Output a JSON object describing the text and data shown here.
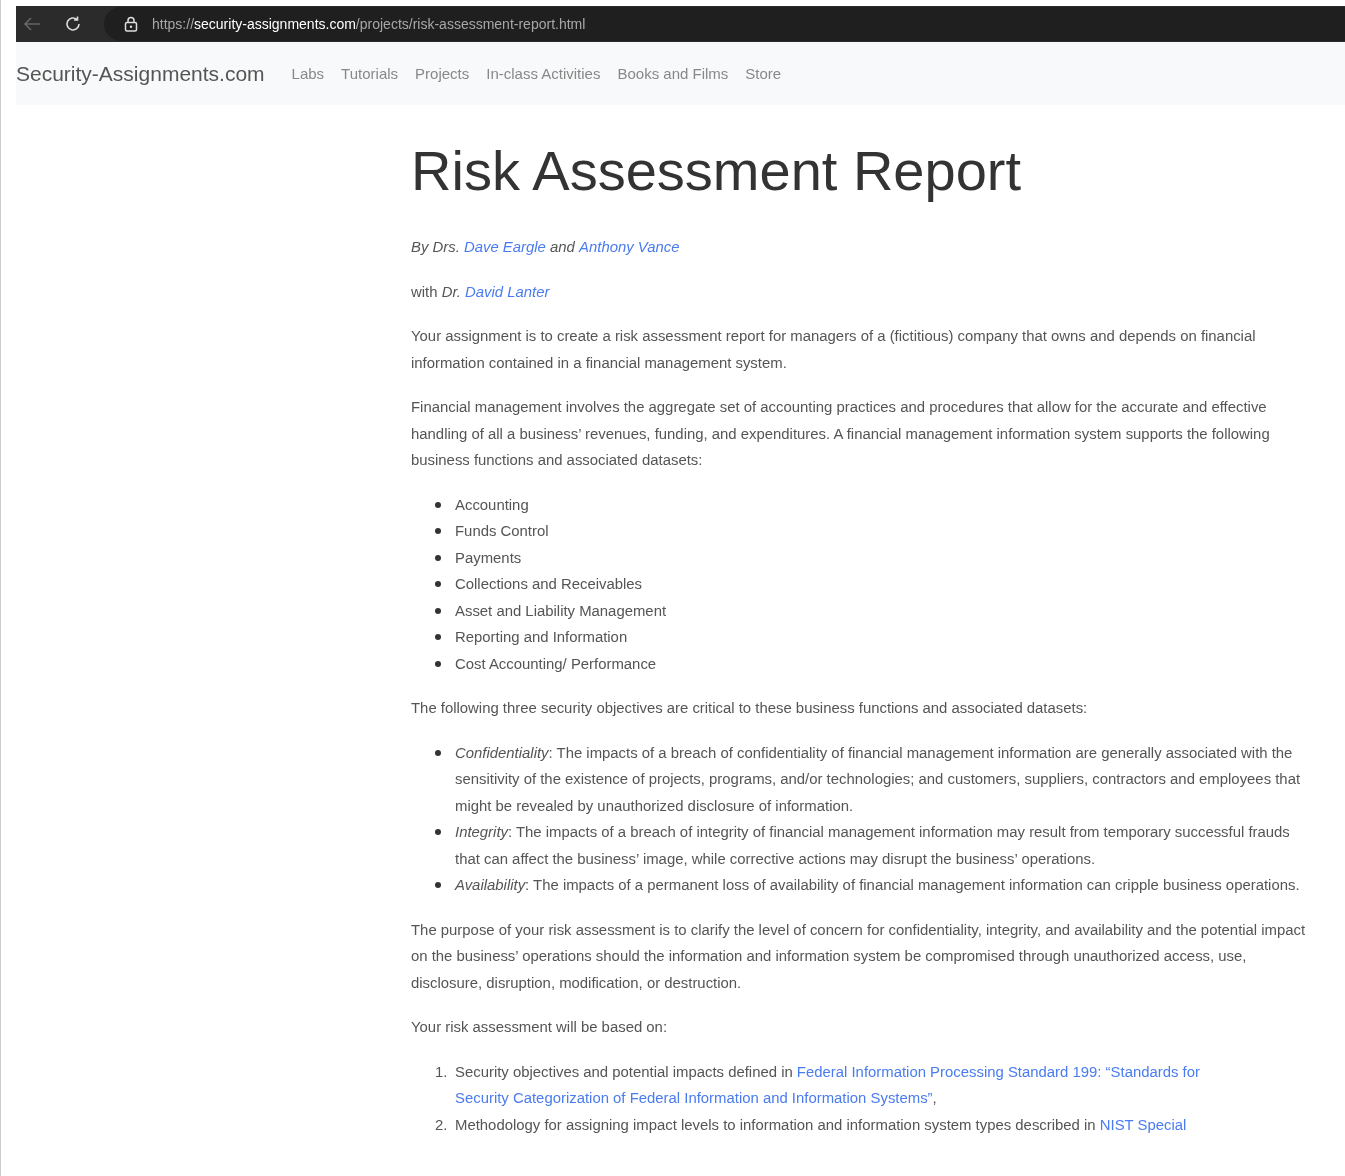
{
  "browser": {
    "url": "https://**security-assignments.com**/projects/risk-assessment-report.html"
  },
  "navbar": {
    "brand": "Security-Assignments.com",
    "links": [
      "Labs",
      "Tutorials",
      "Projects",
      "In-class Activities",
      "Books and Films",
      "Store"
    ]
  },
  "article": {
    "title": "Risk Assessment Report",
    "blocks": [
      {
        "kind": "para",
        "parts": [
          {
            "kind": "text",
            "text": "*By Drs.*"
          },
          {
            "kind": "link",
            "text": "Dave Eargle"
          },
          {
            "kind": "text",
            "text": "*and*"
          },
          {
            "kind": "link",
            "text": "Anthony Vance"
          }
        ]
      },
      {
        "kind": "para",
        "parts": [
          {
            "kind": "text",
            "text": "with *Dr.*"
          },
          {
            "kind": "link",
            "text": "David Lanter"
          }
        ]
      },
      {
        "kind": "para",
        "parts": [
          {
            "kind": "text",
            "text": "Your assignment is to create a risk assessment report for managers of a (fictitious) company that owns and depends on financial information contained in a financial management system."
          }
        ]
      },
      {
        "kind": "para",
        "parts": [
          {
            "kind": "text",
            "text": "Financial management involves the aggregate set of accounting practices and procedures that allow for the accurate and effective handling of all a business’ revenues, funding, and expenditures. A financial management information system supports the following business functions and associated datasets:"
          }
        ]
      },
      {
        "kind": "bullets",
        "items": [
          "Accounting",
          "Funds Control",
          "Payments",
          "Collections and Receivables",
          "Asset and Liability Management",
          "Reporting and Information",
          "Cost Accounting/ Performance"
        ]
      },
      {
        "kind": "para",
        "parts": [
          {
            "kind": "text",
            "text": "The following three security objectives are critical to these business functions and associated datasets:"
          }
        ]
      },
      {
        "kind": "bullets",
        "items": [
          "*Confidentiality*: The impacts of a breach of confidentiality of financial management information are generally associated with the sensitivity of the existence of projects, programs, and/or technologies; and customers, suppliers, contractors and employees that might be revealed by unauthorized disclosure of information.",
          "*Integrity*: The impacts of a breach of integrity of financial management information may result from temporary successful frauds that can affect the business’ image, while corrective actions may disrupt the business’ operations.",
          "*Availability*: The impacts of a permanent loss of availability of financial management information can cripple business operations."
        ]
      },
      {
        "kind": "para",
        "parts": [
          {
            "kind": "text",
            "text": "The purpose of your risk assessment is to clarify the level of concern for confidentiality, integrity, and availability and the potential impact on the business’ operations should the information and information system be compromised through unauthorized access, use, disclosure, disruption, modification, or destruction."
          }
        ]
      },
      {
        "kind": "para",
        "parts": [
          {
            "kind": "text",
            "text": "Your risk assessment will be based on:"
          }
        ]
      },
      {
        "kind": "numbered",
        "items": [
          {
            "number": "1.",
            "parts": [
              {
                "kind": "text",
                "text": "Security objectives and potential impacts defined in"
              },
              {
                "kind": "link",
                "text": "Federal Information Processing Standard 199: “Standards for"
              },
              {
                "kind": "link",
                "text": "Security Categorization of Federal Information and Information Systems”"
              },
              {
                "kind": "text",
                "text": ","
              }
            ]
          },
          {
            "number": "2.",
            "parts": [
              {
                "kind": "text",
                "text": "Methodology for assigning impact levels to information and information system types described in"
              },
              {
                "kind": "link",
                "text": "NIST Special"
              }
            ]
          }
        ]
      }
    ]
  }
}
